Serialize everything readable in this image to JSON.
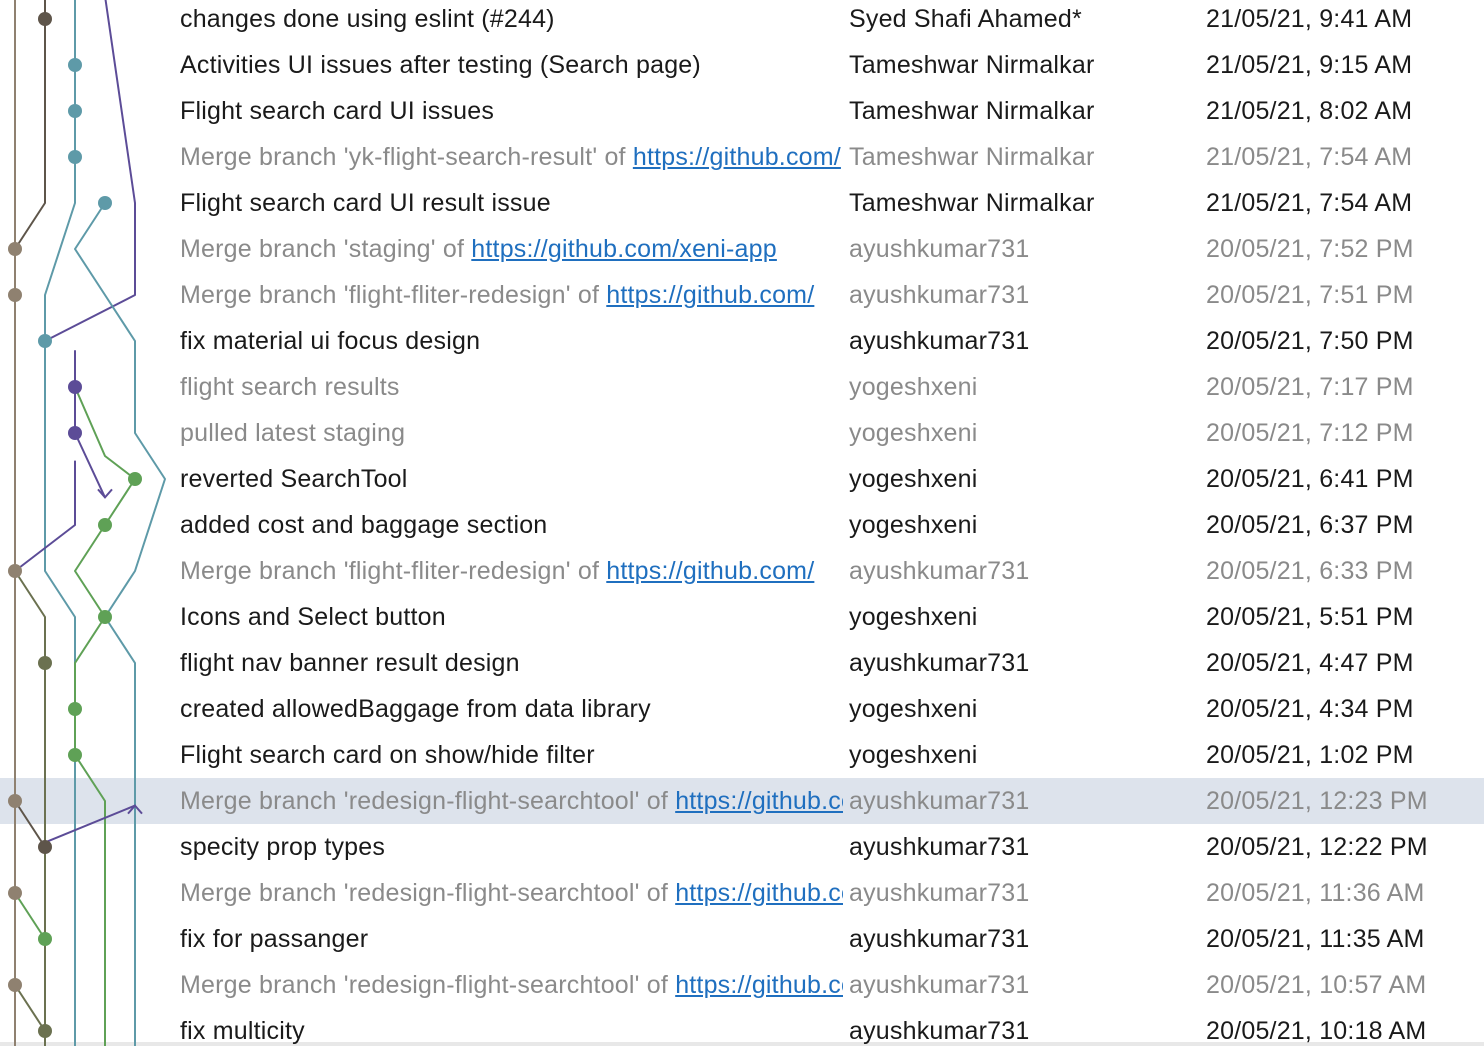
{
  "colors": {
    "tan": "#8f8170",
    "dark": "#5e554a",
    "olive": "#6b7150",
    "teal": "#5e9aa8",
    "purple": "#5c4c97",
    "green": "#5fa156",
    "link": "#1f6fbf",
    "selected_row": "#dde3ec"
  },
  "commits": [
    {
      "message": "changes done using eslint (#244)",
      "author": "Syed Shafi Ahamed*",
      "date": "21/05/21, 9:41 AM",
      "merge": false
    },
    {
      "message": "Activities UI issues after testing (Search page)",
      "author": "Tameshwar Nirmalkar",
      "date": "21/05/21, 9:15 AM",
      "merge": false
    },
    {
      "message": "Flight search card UI issues",
      "author": "Tameshwar Nirmalkar",
      "date": "21/05/21, 8:02 AM",
      "merge": false
    },
    {
      "message": "Merge branch 'yk-flight-search-result' of ",
      "link": "https://github.com/",
      "author": "Tameshwar Nirmalkar",
      "date": "21/05/21, 7:54 AM",
      "merge": true
    },
    {
      "message": "Flight search card UI result issue",
      "author": "Tameshwar Nirmalkar",
      "date": "21/05/21, 7:54 AM",
      "merge": false
    },
    {
      "message": "Merge branch 'staging' of ",
      "link": "https://github.com/xeni-app",
      "author": "ayushkumar731",
      "date": "20/05/21, 7:52 PM",
      "merge": true
    },
    {
      "message": "Merge branch 'flight-fliter-redesign' of ",
      "link": "https://github.com/",
      "author": "ayushkumar731",
      "date": "20/05/21, 7:51 PM",
      "merge": true
    },
    {
      "message": "fix material ui focus design",
      "author": "ayushkumar731",
      "date": "20/05/21, 7:50 PM",
      "merge": false
    },
    {
      "message": "flight search results",
      "author": "yogeshxeni",
      "date": "20/05/21, 7:17 PM",
      "merge": true
    },
    {
      "message": "pulled latest staging",
      "author": "yogeshxeni",
      "date": "20/05/21, 7:12 PM",
      "merge": true
    },
    {
      "message": "reverted SearchTool",
      "author": "yogeshxeni",
      "date": "20/05/21, 6:41 PM",
      "merge": false
    },
    {
      "message": "added cost and baggage section",
      "author": "yogeshxeni",
      "date": "20/05/21, 6:37 PM",
      "merge": false
    },
    {
      "message": "Merge branch 'flight-fliter-redesign' of ",
      "link": "https://github.com/",
      "author": "ayushkumar731",
      "date": "20/05/21, 6:33 PM",
      "merge": true
    },
    {
      "message": "Icons and Select button",
      "author": "yogeshxeni",
      "date": "20/05/21, 5:51 PM",
      "merge": false
    },
    {
      "message": "flight nav banner result design",
      "author": "ayushkumar731",
      "date": "20/05/21, 4:47 PM",
      "merge": false
    },
    {
      "message": "created allowedBaggage from data library",
      "author": "yogeshxeni",
      "date": "20/05/21, 4:34 PM",
      "merge": false
    },
    {
      "message": "Flight search card on show/hide filter",
      "author": "yogeshxeni",
      "date": "20/05/21, 1:02 PM",
      "merge": false
    },
    {
      "message": "Merge branch 'redesign-flight-searchtool' of ",
      "link": "https://github.com/",
      "author": "ayushkumar731",
      "date": "20/05/21, 12:23 PM",
      "merge": true,
      "selected": true
    },
    {
      "message": "specity prop types",
      "author": "ayushkumar731",
      "date": "20/05/21, 12:22 PM",
      "merge": false
    },
    {
      "message": "Merge branch 'redesign-flight-searchtool' of ",
      "link": "https://github.com/",
      "author": "ayushkumar731",
      "date": "20/05/21, 11:36 AM",
      "merge": true
    },
    {
      "message": "fix for passanger",
      "author": "ayushkumar731",
      "date": "20/05/21, 11:35 AM",
      "merge": false
    },
    {
      "message": "Merge branch 'redesign-flight-searchtool' of ",
      "link": "https://github.com/",
      "author": "ayushkumar731",
      "date": "20/05/21, 10:57 AM",
      "merge": true
    },
    {
      "message": "fix multicity",
      "author": "ayushkumar731",
      "date": "20/05/21, 10:18 AM",
      "merge": false
    }
  ],
  "graph": {
    "nodes": [
      {
        "row": 0,
        "lane": 1,
        "color": "dark"
      },
      {
        "row": 1,
        "lane": 2,
        "color": "teal"
      },
      {
        "row": 2,
        "lane": 2,
        "color": "teal"
      },
      {
        "row": 3,
        "lane": 2,
        "color": "teal"
      },
      {
        "row": 4,
        "lane": 3,
        "color": "teal"
      },
      {
        "row": 5,
        "lane": 0,
        "color": "tan"
      },
      {
        "row": 6,
        "lane": 0,
        "color": "tan"
      },
      {
        "row": 7,
        "lane": 1,
        "color": "teal"
      },
      {
        "row": 8,
        "lane": 2,
        "color": "purple"
      },
      {
        "row": 9,
        "lane": 2,
        "color": "purple"
      },
      {
        "row": 10,
        "lane": 4,
        "color": "green"
      },
      {
        "row": 11,
        "lane": 3,
        "color": "green"
      },
      {
        "row": 12,
        "lane": 0,
        "color": "tan"
      },
      {
        "row": 13,
        "lane": 3,
        "color": "green"
      },
      {
        "row": 14,
        "lane": 1,
        "color": "olive"
      },
      {
        "row": 15,
        "lane": 2,
        "color": "green"
      },
      {
        "row": 16,
        "lane": 2,
        "color": "green"
      },
      {
        "row": 17,
        "lane": 0,
        "color": "tan"
      },
      {
        "row": 18,
        "lane": 1,
        "color": "dark"
      },
      {
        "row": 19,
        "lane": 0,
        "color": "tan"
      },
      {
        "row": 20,
        "lane": 1,
        "color": "green"
      },
      {
        "row": 21,
        "lane": 0,
        "color": "tan"
      },
      {
        "row": 22,
        "lane": 1,
        "color": "olive"
      }
    ],
    "edges": [
      {
        "color": "tan",
        "lanes": [
          [
            -0.5,
            0
          ],
          [
            23,
            0
          ]
        ]
      },
      {
        "color": "dark",
        "lanes": [
          [
            -0.5,
            1
          ],
          [
            0,
            1
          ],
          [
            4,
            1
          ],
          [
            5,
            0
          ]
        ]
      },
      {
        "color": "teal",
        "lanes": [
          [
            -0.5,
            2
          ],
          [
            4,
            2
          ],
          [
            6,
            1
          ],
          [
            7,
            1
          ],
          [
            7.5,
            1
          ],
          [
            12,
            1
          ],
          [
            13,
            2
          ],
          [
            14,
            2
          ],
          [
            17,
            2
          ],
          [
            17.5,
            2
          ],
          [
            23,
            2
          ]
        ]
      },
      {
        "color": "purple",
        "lanes": [
          [
            -0.5,
            3
          ],
          [
            4,
            4
          ],
          [
            6,
            4
          ],
          [
            7,
            1
          ]
        ]
      },
      {
        "color": "teal",
        "lanes": [
          [
            4,
            3
          ],
          [
            5,
            2
          ],
          [
            6,
            3
          ],
          [
            7,
            4
          ],
          [
            9,
            4
          ],
          [
            10,
            5
          ],
          [
            12,
            4
          ],
          [
            13,
            3
          ],
          [
            14,
            4
          ],
          [
            23,
            4
          ]
        ]
      },
      {
        "color": "purple",
        "lanes": [
          [
            7.2,
            2
          ],
          [
            9,
            2
          ],
          [
            10.4,
            3
          ]
        ]
      },
      {
        "color": "green",
        "lanes": [
          [
            8,
            2
          ],
          [
            9.5,
            3
          ],
          [
            10,
            4
          ],
          [
            11,
            3
          ],
          [
            12,
            2
          ],
          [
            13,
            3
          ],
          [
            14,
            2
          ],
          [
            16,
            2
          ],
          [
            17,
            3
          ],
          [
            23,
            3
          ]
        ]
      },
      {
        "color": "purple",
        "lanes": [
          [
            9.6,
            2
          ],
          [
            11,
            2
          ],
          [
            12,
            0
          ]
        ]
      },
      {
        "color": "olive",
        "lanes": [
          [
            12,
            0
          ],
          [
            13,
            1
          ],
          [
            14,
            1
          ],
          [
            16,
            1
          ],
          [
            17,
            1
          ],
          [
            18,
            1
          ],
          [
            23,
            1
          ]
        ]
      },
      {
        "color": "purple",
        "lanes": [
          [
            17.9,
            1
          ],
          [
            17.1,
            4
          ]
        ]
      },
      {
        "color": "dark",
        "lanes": [
          [
            17,
            0
          ],
          [
            18,
            1
          ]
        ]
      },
      {
        "color": "green",
        "lanes": [
          [
            19,
            0
          ],
          [
            20,
            1
          ]
        ]
      },
      {
        "color": "olive",
        "lanes": [
          [
            21,
            0
          ],
          [
            22,
            1
          ]
        ]
      }
    ],
    "arrows": [
      {
        "row": 10.4,
        "lane": 3,
        "dir": "down",
        "color": "purple"
      },
      {
        "row": 17.1,
        "lane": 4,
        "dir": "up",
        "color": "purple"
      }
    ]
  }
}
